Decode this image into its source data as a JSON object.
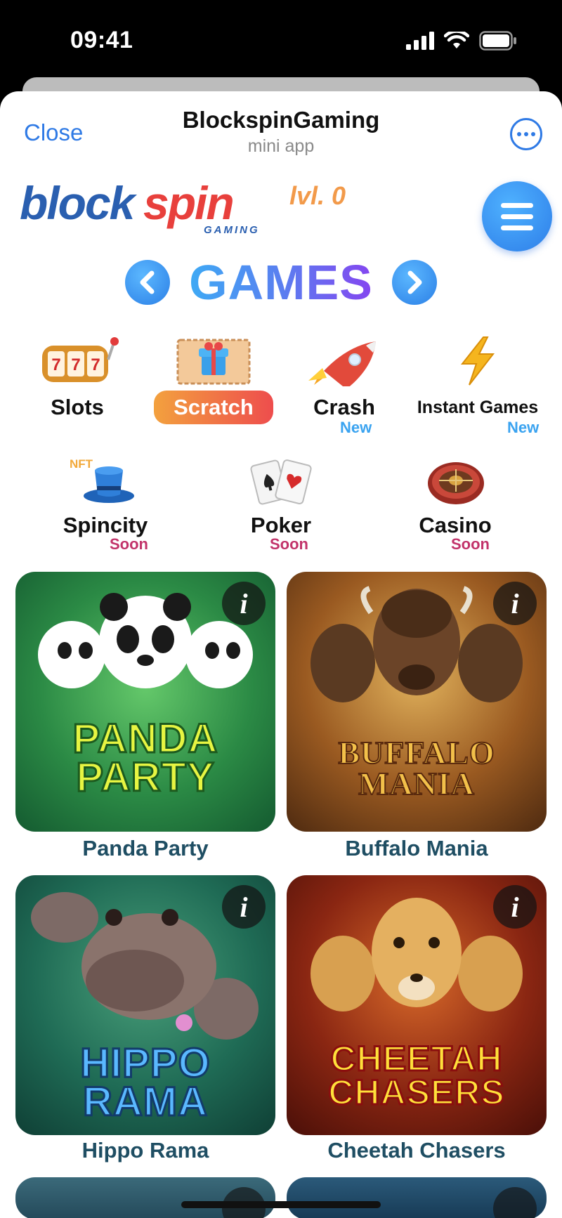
{
  "status_bar": {
    "time": "09:41"
  },
  "header": {
    "close_label": "Close",
    "title": "BlockspinGaming",
    "subtitle": "mini app"
  },
  "brand": {
    "logo_text": "blockspin",
    "logo_sub": "GAMING",
    "level": "lvl. 0"
  },
  "section_title": "GAMES",
  "categories_row1": [
    {
      "label": "Slots",
      "badge": ""
    },
    {
      "label": "Scratch",
      "badge": ""
    },
    {
      "label": "Crash",
      "badge": "New"
    },
    {
      "label": "Instant Games",
      "badge": "New"
    }
  ],
  "categories_row2": [
    {
      "label": "Spincity",
      "badge": "Soon",
      "tag": "NFT"
    },
    {
      "label": "Poker",
      "badge": "Soon"
    },
    {
      "label": "Casino",
      "badge": "Soon"
    }
  ],
  "games": [
    {
      "name": "Panda Party",
      "art_line1": "PANDA",
      "art_line2": "PARTY"
    },
    {
      "name": "Buffalo Mania",
      "art_line1": "BUFFALO",
      "art_line2": "MANIA"
    },
    {
      "name": "Hippo Rama",
      "art_line1": "HIPPO",
      "art_line2": "RAMA"
    },
    {
      "name": "Cheetah Chasers",
      "art_line1": "CHEETAH",
      "art_line2": "CHASERS"
    }
  ],
  "info_glyph": "i",
  "colors": {
    "accent": "#2f7ae5",
    "new_badge": "#3aa3f0",
    "soon_badge": "#c2336a",
    "game_name": "#1f4e63"
  }
}
